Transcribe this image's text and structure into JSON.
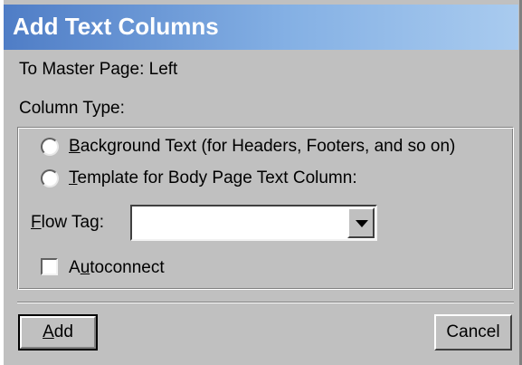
{
  "window": {
    "title": "Add Text Columns"
  },
  "master_page": {
    "text": "To Master Page:  Left"
  },
  "column_type": {
    "label": "Column Type:",
    "options": [
      {
        "mnemonic": "B",
        "rest": "ackground Text (for Headers, Footers, and so on)"
      },
      {
        "mnemonic": "T",
        "rest": "emplate for Body Page Text Column:"
      }
    ]
  },
  "flow_tag": {
    "mnemonic": "F",
    "rest": "low Tag:",
    "value": ""
  },
  "autoconnect": {
    "pre": "A",
    "mnemonic": "u",
    "rest": "toconnect",
    "checked": false
  },
  "buttons": {
    "add": {
      "mnemonic": "A",
      "rest": "dd"
    },
    "cancel": {
      "label": "Cancel"
    }
  }
}
